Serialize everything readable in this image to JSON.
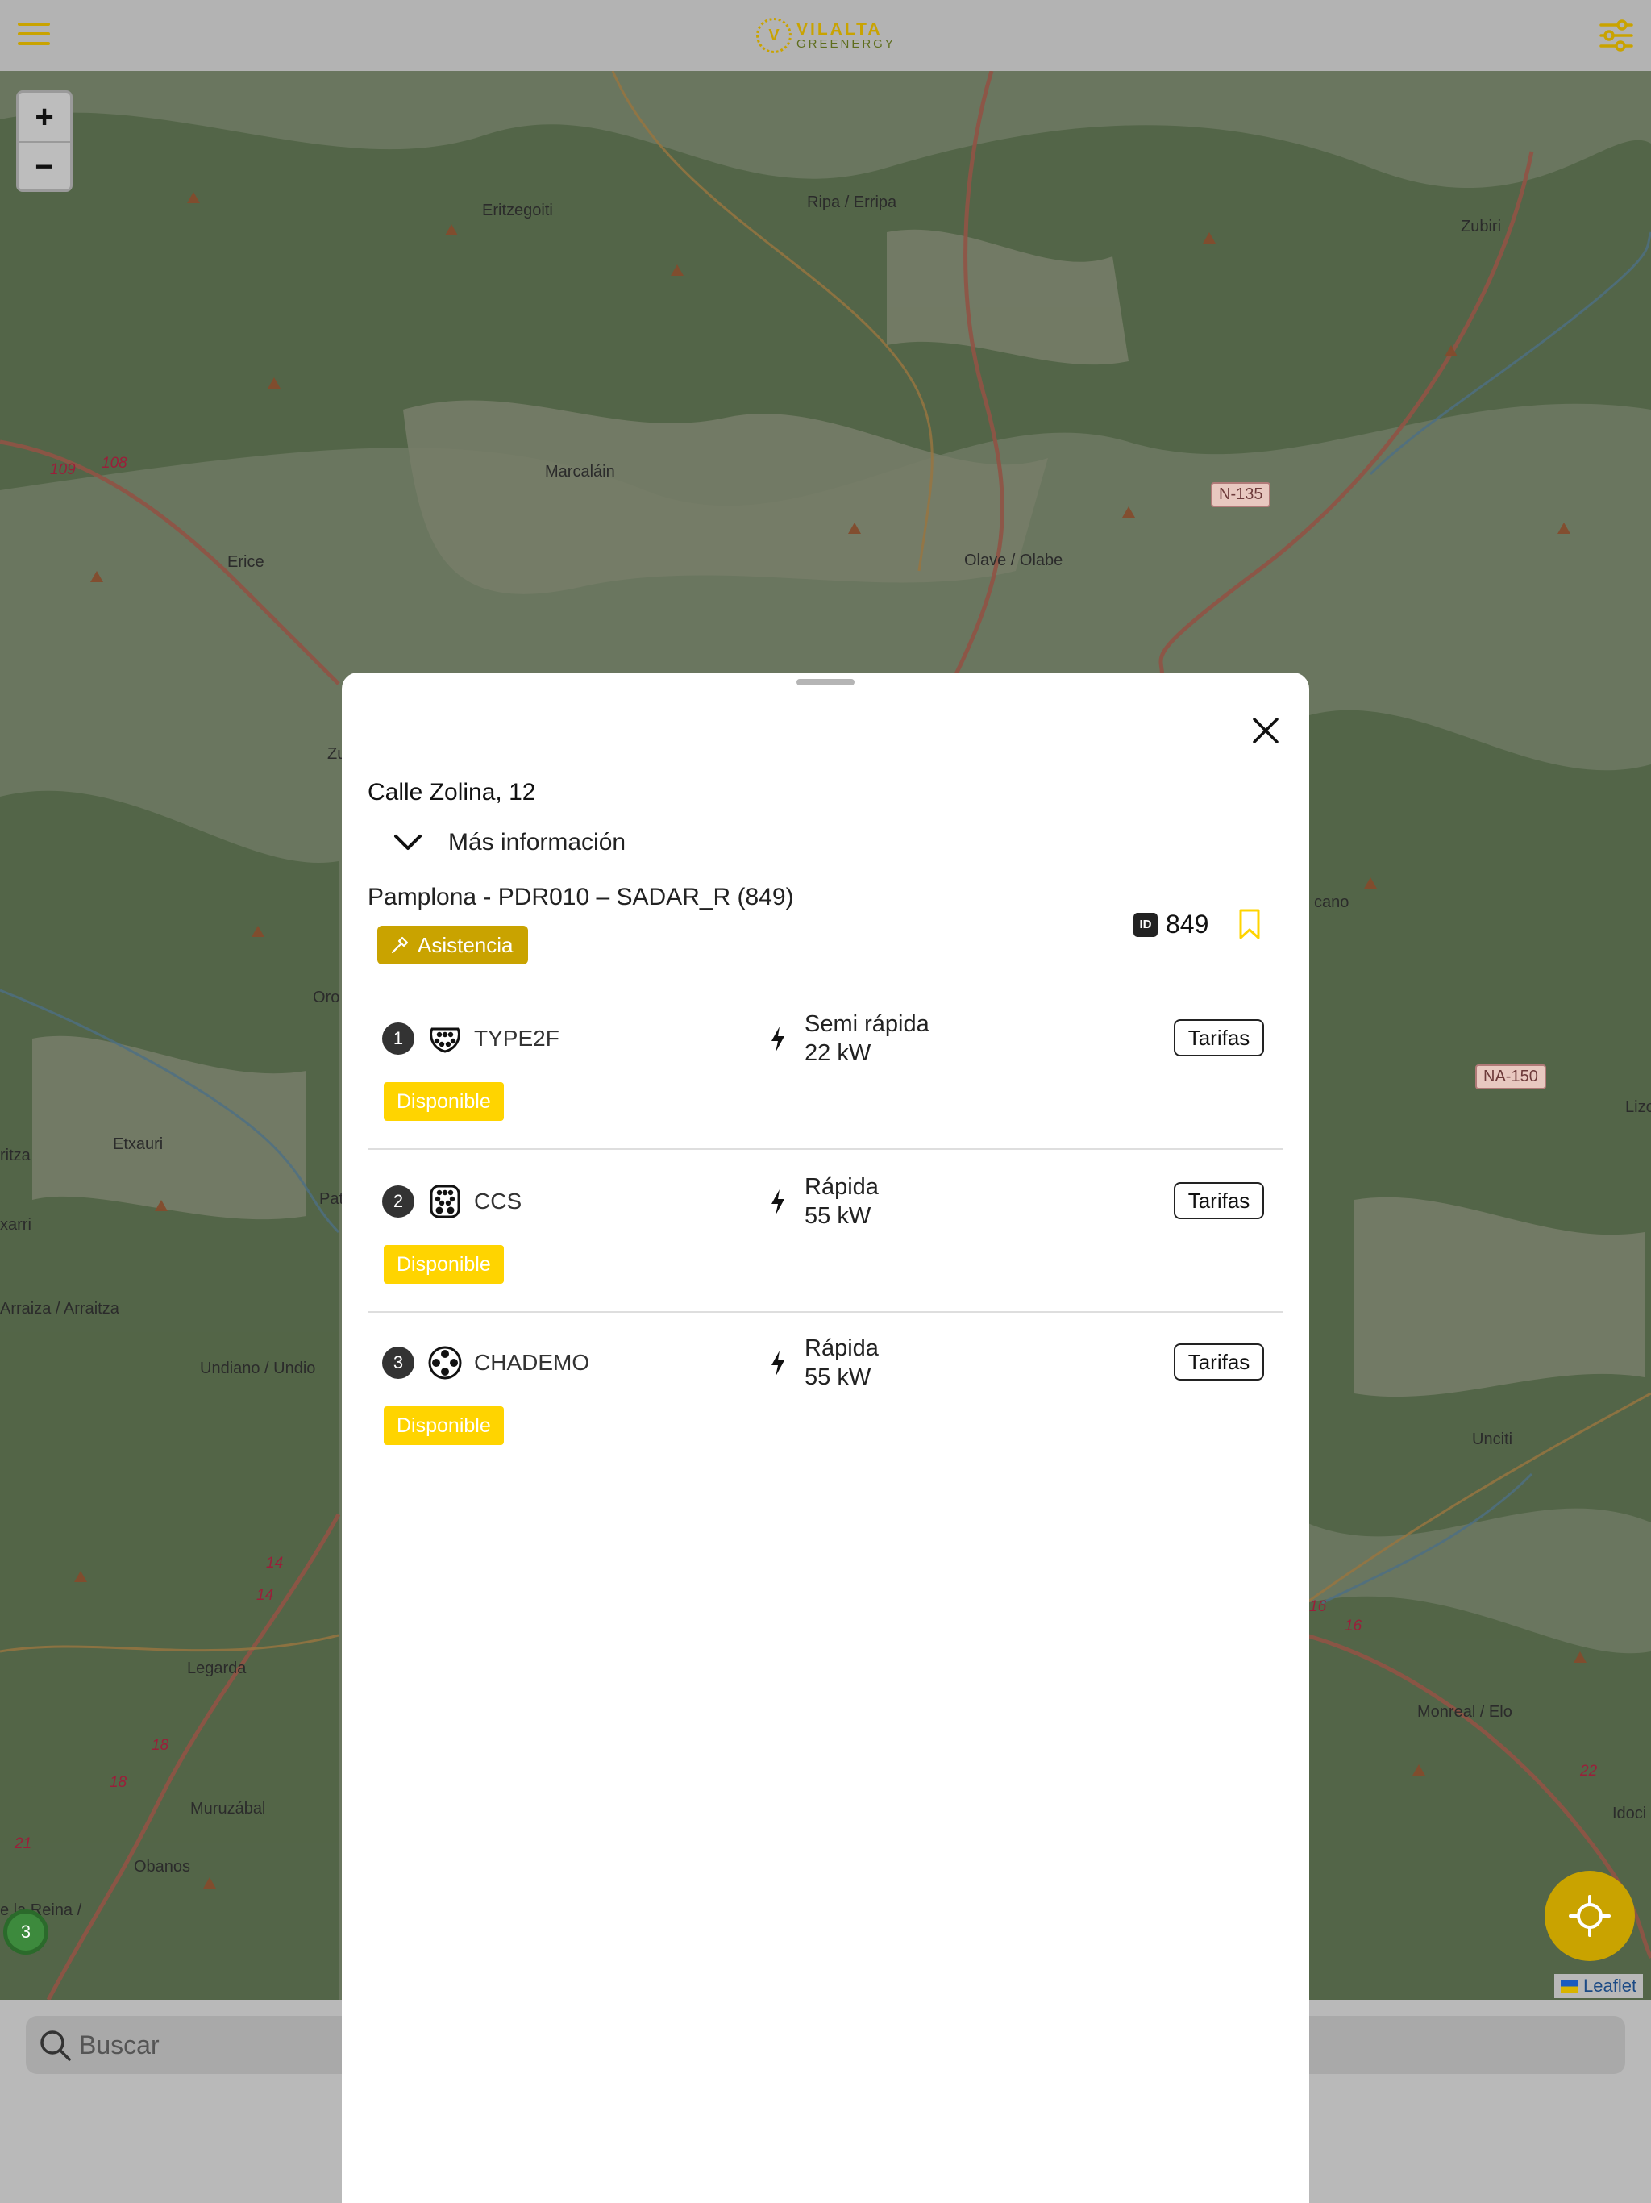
{
  "header": {
    "menu_icon": "hamburger-menu-icon",
    "logo": {
      "mark": "V",
      "line1": "VILALTA",
      "line2": "GREENERGY"
    },
    "filter_icon": "sliders-filter-icon"
  },
  "map": {
    "zoom_in": "+",
    "zoom_out": "−",
    "places": [
      "Eritzegoiti",
      "Ripa / Erripa",
      "Zubiri",
      "Marcaláin",
      "Erice",
      "Olave / Olabe",
      "Zu",
      "Oro",
      "Etxauri",
      "ritza",
      "xarri",
      "Pat",
      "Arraiza / Arraitza",
      "Undiano / Undio",
      "Legarda",
      "Muruzábal",
      "Obanos",
      "e la Reina /",
      "Unciti",
      "Monreal / Elo",
      "Idoci",
      "cano",
      "Lizo"
    ],
    "roads": [
      "N-135",
      "NA-150"
    ],
    "road_numbers": [
      "109",
      "108",
      "14",
      "14",
      "18",
      "18",
      "21",
      "16",
      "16",
      "22"
    ],
    "cluster_count": "3",
    "attribution": "Leaflet",
    "locate_icon": "crosshair-locate-icon"
  },
  "search": {
    "placeholder": "Buscar"
  },
  "sheet": {
    "address": "Calle Zolina, 12",
    "more_info": "Más información",
    "station_name": "Pamplona - PDR010 – SADAR_R (849)",
    "assist_label": "Asistencia",
    "id_tag": "ID",
    "id_value": "849",
    "connectors": [
      {
        "index": "1",
        "type": "TYPE2F",
        "speed": "Semi rápida",
        "power": "22 kW",
        "tariff_label": "Tarifas",
        "status": "Disponible"
      },
      {
        "index": "2",
        "type": "CCS",
        "speed": "Rápida",
        "power": "55 kW",
        "tariff_label": "Tarifas",
        "status": "Disponible"
      },
      {
        "index": "3",
        "type": "CHADEMO",
        "speed": "Rápida",
        "power": "55 kW",
        "tariff_label": "Tarifas",
        "status": "Disponible"
      }
    ]
  },
  "colors": {
    "brand": "#c9a300",
    "status_available": "#ffd400",
    "map_dim": "#000000"
  }
}
